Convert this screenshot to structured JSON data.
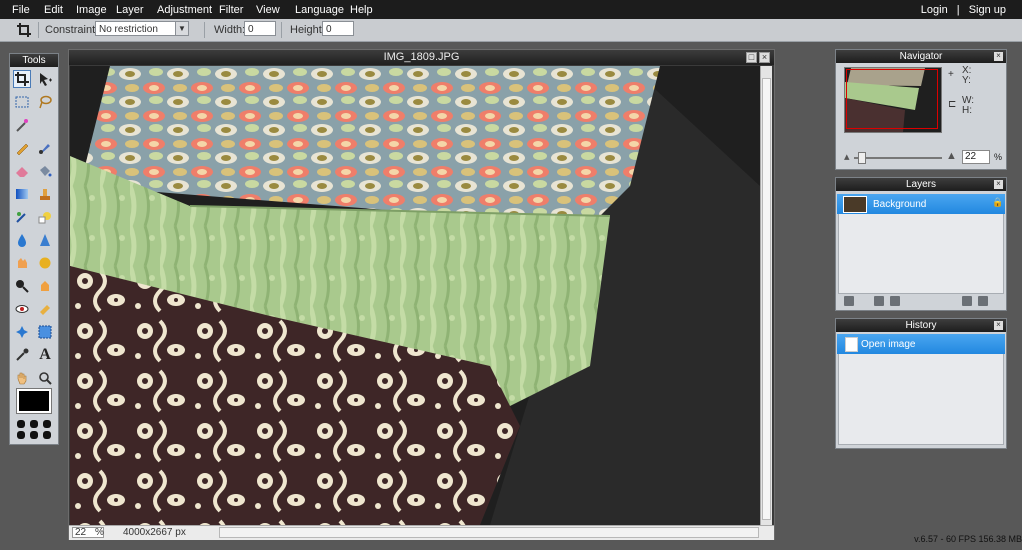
{
  "menubar": {
    "items": [
      "File",
      "Edit",
      "Image",
      "Layer",
      "Adjustment",
      "Filter",
      "View",
      "Language",
      "Help"
    ],
    "login": "Login",
    "separator": "|",
    "signup": "Sign up"
  },
  "options": {
    "constraint_label": "Constraint:",
    "constraint_value": "No restriction",
    "width_label": "Width:",
    "width_value": "0",
    "height_label": "Height:",
    "height_value": "0"
  },
  "tools": {
    "title": "Tools",
    "icons": [
      "crop-icon",
      "move-icon",
      "marquee-icon",
      "lasso-icon",
      "wand-icon",
      "pencil-icon",
      "brush-icon",
      "eraser-icon",
      "bucket-icon",
      "gradient-icon",
      "stamp-icon",
      "colorreplace-icon",
      "drawing-icon",
      "blur-icon",
      "sharpen-icon",
      "smudge-icon",
      "sponge-icon",
      "dodge-icon",
      "burn-icon",
      "redeye-icon",
      "spot-icon",
      "bloat-icon",
      "pinch-icon",
      "colorpicker-icon",
      "type-icon",
      "hand-icon",
      "zoom-icon"
    ]
  },
  "image_window": {
    "title": "IMG_1809.JPG",
    "zoom": "22",
    "zoom_unit": "%",
    "dimensions": "4000x2667 px"
  },
  "navigator": {
    "title": "Navigator",
    "x_label": "X:",
    "y_label": "Y:",
    "w_label": "W:",
    "h_label": "H:",
    "zoom_value": "22",
    "zoom_unit": "%"
  },
  "layers": {
    "title": "Layers",
    "items": [
      {
        "name": "Background"
      }
    ]
  },
  "history": {
    "title": "History",
    "items": [
      {
        "name": "Open image"
      }
    ]
  },
  "status": {
    "version": "v.6.57 - 60 FPS 156.38 MB"
  },
  "colors": {
    "selection": "#2b8ee6",
    "panel_bg": "#cfd3d8",
    "menubar": "#1c1c1c",
    "foreground": "#000000"
  }
}
